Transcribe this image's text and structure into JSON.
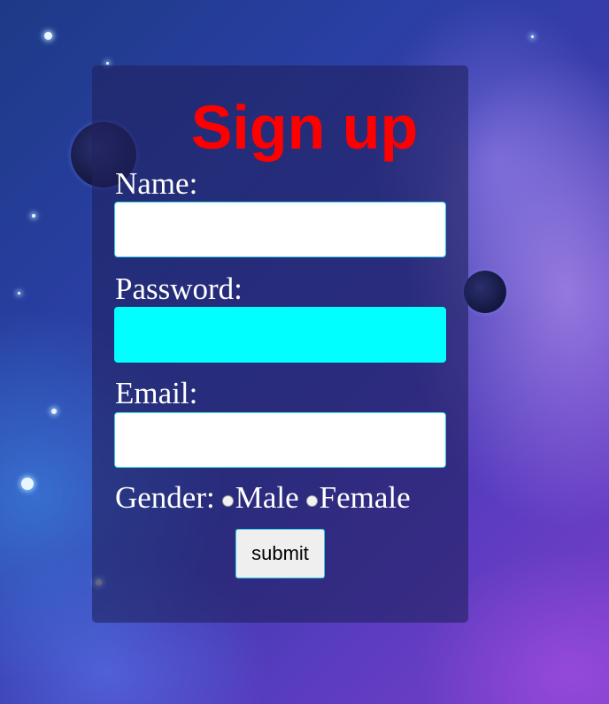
{
  "form": {
    "title": "Sign up",
    "name_label": "Name:",
    "name_value": "",
    "password_label": "Password:",
    "password_value": "",
    "email_label": "Email:",
    "email_value": "",
    "gender_label": "Gender:",
    "gender_options": [
      "Male",
      "Female"
    ],
    "submit_label": "submit"
  },
  "colors": {
    "title": "#ff0000",
    "focused_field": "#00ffff",
    "field_border": "#33d0e6",
    "label_text": "#ffffff"
  },
  "background": {
    "description_icon": "galaxy-nebula-background"
  }
}
